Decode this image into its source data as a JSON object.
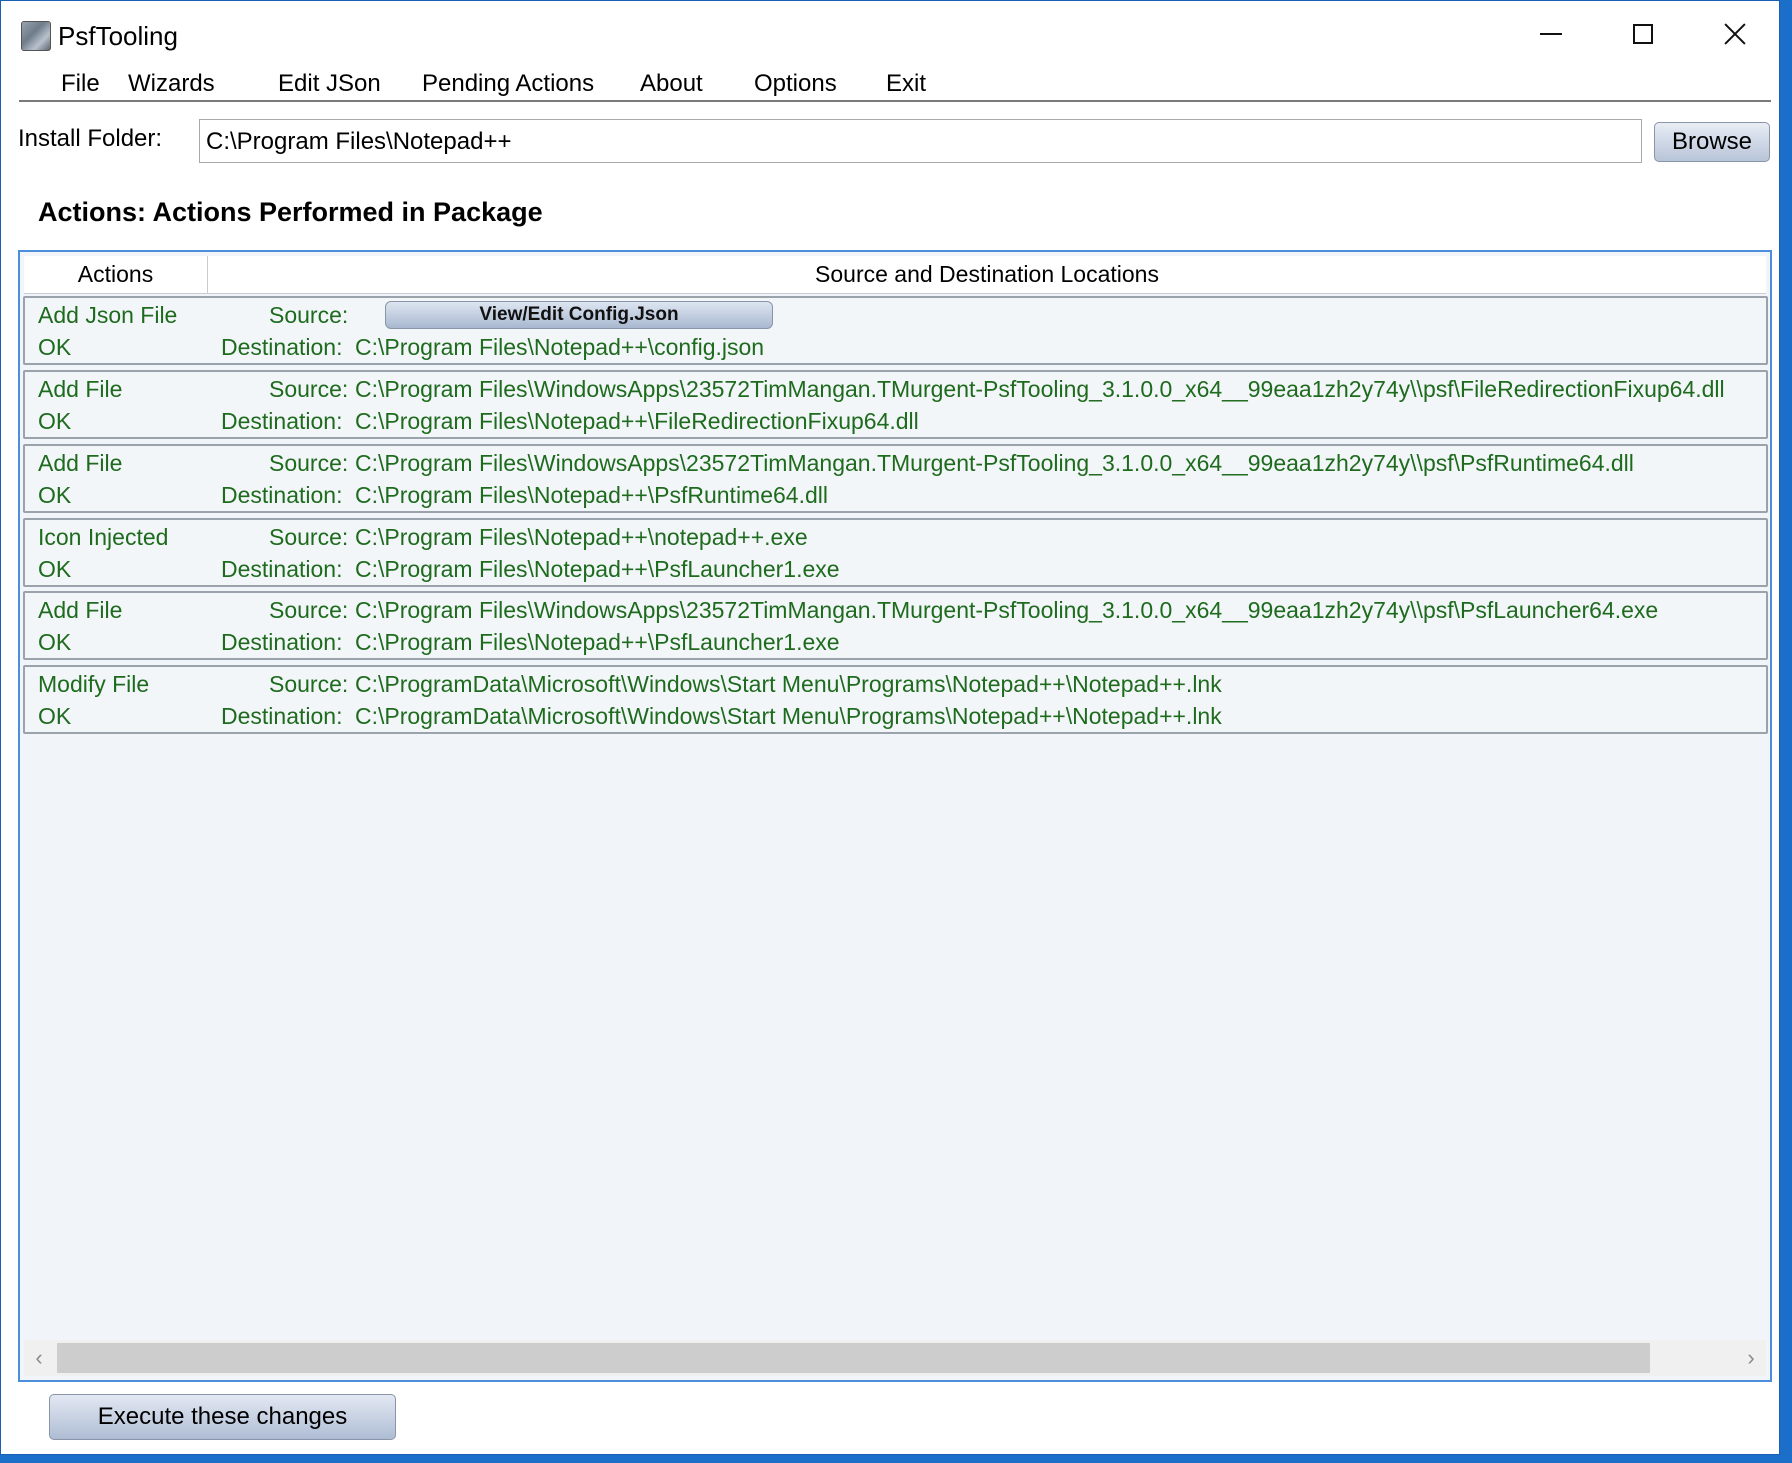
{
  "window": {
    "title": "PsfTooling",
    "minimize_icon": "minimize-icon",
    "maximize_icon": "maximize-icon",
    "close_icon": "close-icon"
  },
  "menu": {
    "items": [
      "File",
      "Wizards",
      "Edit JSon",
      "Pending Actions",
      "About",
      "Options",
      "Exit"
    ]
  },
  "install": {
    "label": "Install Folder:",
    "value": "C:\\Program Files\\Notepad++",
    "browse_label": "Browse"
  },
  "section": {
    "title": "Actions: Actions Performed in Package"
  },
  "grid": {
    "headers": {
      "actions": "Actions",
      "locations": "Source and Destination Locations"
    },
    "rows": [
      {
        "action": "Add Json File",
        "status": "OK",
        "source_label": "Source:",
        "source_button": "View/Edit Config.Json",
        "destination_label": "Destination:",
        "destination": "C:\\Program Files\\Notepad++\\config.json"
      },
      {
        "action": "Add File",
        "status": "OK",
        "source_label": "Source:",
        "source": "C:\\Program Files\\WindowsApps\\23572TimMangan.TMurgent-PsfTooling_3.1.0.0_x64__99eaa1zh2y74y\\\\psf\\FileRedirectionFixup64.dll",
        "destination_label": "Destination:",
        "destination": "C:\\Program Files\\Notepad++\\FileRedirectionFixup64.dll"
      },
      {
        "action": "Add File",
        "status": "OK",
        "source_label": "Source:",
        "source": "C:\\Program Files\\WindowsApps\\23572TimMangan.TMurgent-PsfTooling_3.1.0.0_x64__99eaa1zh2y74y\\\\psf\\PsfRuntime64.dll",
        "destination_label": "Destination:",
        "destination": "C:\\Program Files\\Notepad++\\PsfRuntime64.dll"
      },
      {
        "action": "Icon Injected",
        "status": "OK",
        "source_label": "Source:",
        "source": "C:\\Program Files\\Notepad++\\notepad++.exe",
        "destination_label": "Destination:",
        "destination": "C:\\Program Files\\Notepad++\\PsfLauncher1.exe"
      },
      {
        "action": "Add File",
        "status": "OK",
        "source_label": "Source:",
        "source": "C:\\Program Files\\WindowsApps\\23572TimMangan.TMurgent-PsfTooling_3.1.0.0_x64__99eaa1zh2y74y\\\\psf\\PsfLauncher64.exe",
        "destination_label": "Destination:",
        "destination": "C:\\Program Files\\Notepad++\\PsfLauncher1.exe"
      },
      {
        "action": "Modify File",
        "status": "OK",
        "source_label": "Source:",
        "source": "C:\\ProgramData\\Microsoft\\Windows\\Start Menu\\Programs\\Notepad++\\Notepad++.lnk",
        "destination_label": "Destination:",
        "destination": "C:\\ProgramData\\Microsoft\\Windows\\Start Menu\\Programs\\Notepad++\\Notepad++.lnk"
      }
    ]
  },
  "scrollbar": {
    "left_arrow": "‹",
    "right_arrow": "›"
  },
  "footer": {
    "execute_label": "Execute these changes"
  },
  "colors": {
    "row_text": "#1e6b1e",
    "grid_border": "#4c8ed9",
    "desktop": "#1b6fc9"
  }
}
